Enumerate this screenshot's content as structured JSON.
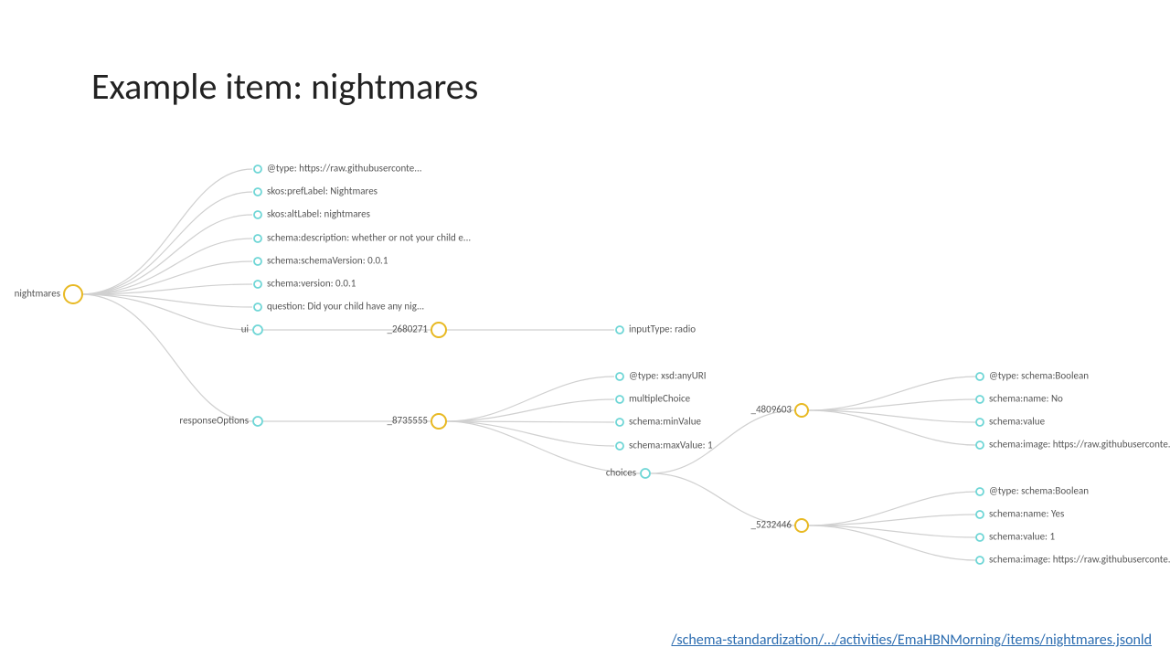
{
  "title": "Example item: nightmares",
  "footer_link": "/schema-standardization/…/activities/EmaHBNMorning/items/nightmares.jsonld",
  "root": {
    "label": "nightmares"
  },
  "root_children": [
    {
      "label": "@type: https://raw.githubuserconte..."
    },
    {
      "label": "skos:prefLabel: Nightmares"
    },
    {
      "label": "skos:altLabel: nightmares"
    },
    {
      "label": "schema:description: whether or not your child e..."
    },
    {
      "label": "schema:schemaVersion: 0.0.1"
    },
    {
      "label": "schema:version: 0.0.1"
    },
    {
      "label": "question: Did your child have any nig..."
    }
  ],
  "ui": {
    "label": "ui",
    "node_id": "_2680271",
    "leaf": "inputType: radio"
  },
  "responseOptions": {
    "label": "responseOptions",
    "node_id": "_8735555",
    "leaves": [
      "@type: xsd:anyURI",
      "multipleChoice",
      "schema:minValue",
      "schema:maxValue: 1"
    ],
    "choices_label": "choices",
    "choices": [
      {
        "node_id": "_4809603",
        "leaves": [
          "@type: schema:Boolean",
          "schema:name: No",
          "schema:value",
          "schema:image: https://raw.githubuserconte..."
        ]
      },
      {
        "node_id": "_5232446",
        "leaves": [
          "@type: schema:Boolean",
          "schema:name: Yes",
          "schema:value: 1",
          "schema:image: https://raw.githubuserconte..."
        ]
      }
    ]
  }
}
